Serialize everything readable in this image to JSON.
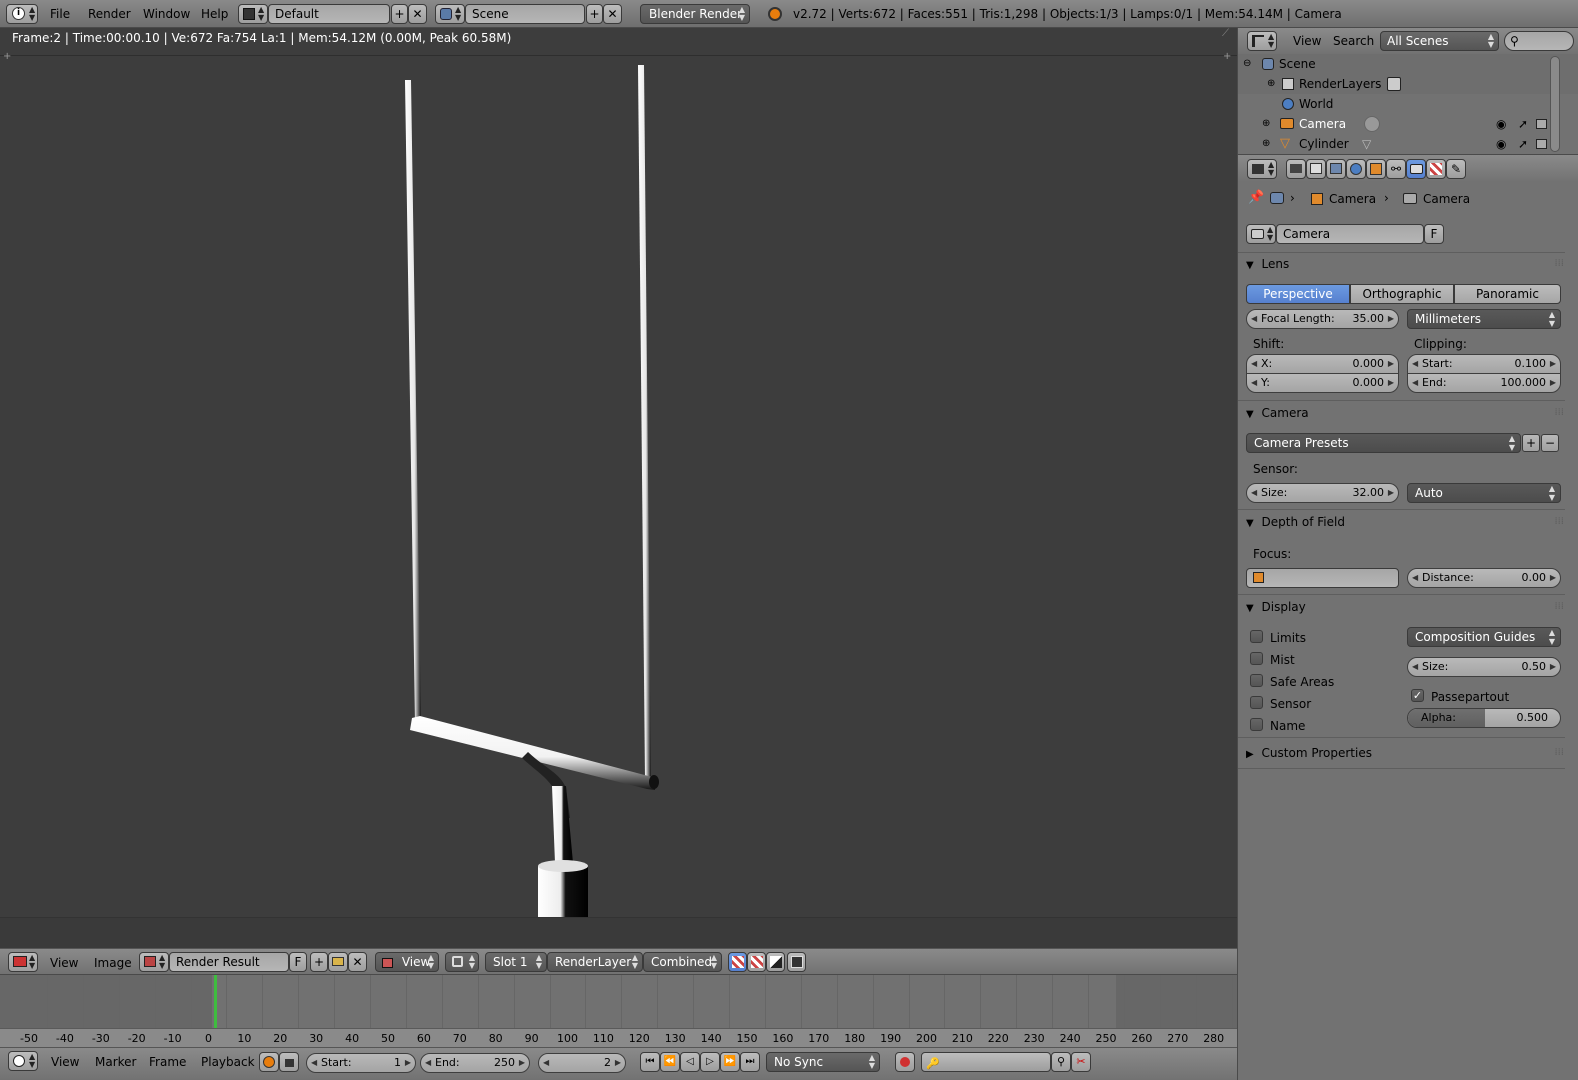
{
  "topbar": {
    "menus": [
      "File",
      "Render",
      "Window",
      "Help"
    ],
    "layout_name": "Default",
    "scene_name": "Scene",
    "engine": "Blender Render",
    "stats": "v2.72 | Verts:672 | Faces:551 | Tris:1,298 | Objects:1/3 | Lamps:0/1 | Mem:54.14M | Camera"
  },
  "viewport": {
    "info": "Frame:2 | Time:00:00.10 | Ve:672 Fa:754 La:1 | Mem:54.12M (0.00M, Peak 60.58M)"
  },
  "image_editor": {
    "menus": [
      "View",
      "Image"
    ],
    "image_name": "Render Result",
    "fake_user": "F",
    "view_label": "View",
    "slot": "Slot 1",
    "layer": "RenderLayer",
    "pass": "Combined"
  },
  "timeline": {
    "ticks": [
      "-50",
      "-40",
      "-30",
      "-20",
      "-10",
      "0",
      "10",
      "20",
      "30",
      "40",
      "50",
      "60",
      "70",
      "80",
      "90",
      "100",
      "110",
      "120",
      "130",
      "140",
      "150",
      "160",
      "170",
      "180",
      "190",
      "200",
      "210",
      "220",
      "230",
      "240",
      "250",
      "260",
      "270",
      "280"
    ],
    "current_frame_marker": 2,
    "menus": [
      "View",
      "Marker",
      "Frame",
      "Playback"
    ],
    "start_label": "Start:",
    "start": "1",
    "end_label": "End:",
    "end": "250",
    "frame": "2",
    "sync": "No Sync"
  },
  "outliner": {
    "menus": [
      "View",
      "Search"
    ],
    "filter": "All Scenes",
    "items": [
      {
        "label": "Scene"
      },
      {
        "label": "RenderLayers"
      },
      {
        "label": "World"
      },
      {
        "label": "Camera"
      },
      {
        "label": "Cylinder"
      }
    ]
  },
  "properties": {
    "breadcrumb": [
      "Camera",
      "Camera"
    ],
    "datablock": "Camera",
    "fake_user": "F",
    "lens": {
      "title": "Lens",
      "types": [
        "Perspective",
        "Orthographic",
        "Panoramic"
      ],
      "active_type": "Perspective",
      "focal_label": "Focal Length:",
      "focal_value": "35.00",
      "unit": "Millimeters",
      "shift_label": "Shift:",
      "shift_x_label": "X:",
      "shift_x": "0.000",
      "shift_y_label": "Y:",
      "shift_y": "0.000",
      "clip_label": "Clipping:",
      "clip_start_label": "Start:",
      "clip_start": "0.100",
      "clip_end_label": "End:",
      "clip_end": "100.000"
    },
    "camera": {
      "title": "Camera",
      "presets": "Camera Presets",
      "sensor_label": "Sensor:",
      "size_label": "Size:",
      "size_value": "32.00",
      "fit": "Auto"
    },
    "dof": {
      "title": "Depth of Field",
      "focus_label": "Focus:",
      "distance_label": "Distance:",
      "distance_value": "0.00"
    },
    "display": {
      "title": "Display",
      "checks": [
        "Limits",
        "Mist",
        "Safe Areas",
        "Sensor",
        "Name"
      ],
      "guides": "Composition Guides",
      "size_label": "Size:",
      "size_value": "0.50",
      "passepartout": "Passepartout",
      "passepartout_checked": true,
      "alpha_label": "Alpha:",
      "alpha_value": "0.500",
      "alpha_fraction": 0.5
    },
    "custom_props": {
      "title": "Custom Properties"
    }
  }
}
